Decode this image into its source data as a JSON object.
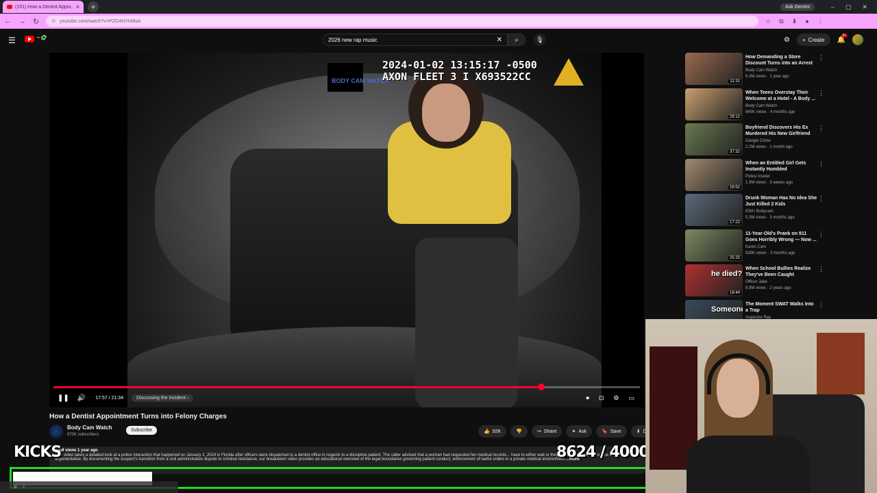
{
  "browser": {
    "tab_title": "(151) How a Dentist Appoi...",
    "url": "youtube.com/watch?v=PZG4NYHi8sA",
    "ask_gemini": "Ask Gemini"
  },
  "masthead": {
    "search_query": "2026 new rap music",
    "create_label": "Create",
    "notif_count": "9+"
  },
  "player": {
    "cam_timestamp": "2024-01-02 13:15:17 -0500",
    "cam_device": "AXON FLEET 3 I X693522CC",
    "watermark": "BODY CAM WATCH",
    "current_time": "17:57",
    "duration": "21:34",
    "time_display": "17:57 / 21:34",
    "chapter": "Discussing the Incident",
    "progress": 0.832
  },
  "video": {
    "title": "How a Dentist Appointment Turns into Felony Charges",
    "channel": "Body Cam Watch",
    "subscribers": "970K subscribers",
    "subscribe_label": "Subscribe",
    "likes": "92K",
    "share_label": "Share",
    "ask_label": "Ask",
    "save_label": "Save",
    "download_label": "Dow",
    "views_date": "2.8M views  1 year ago",
    "description": "This video takes a detailed look at a police interaction that happened on January 2, 2024 in Florida after officers were dispatched to a dentist office in regards to a disruptive patient. The caller advised that a woman had requested her medical records... have to either wait or they could be mailed to her, she became argumentative. By documenting the suspect's transition from a civil administrative dispute to criminal resistance, our breakdown video provides an educational overview of the legal boundaries governing patient conduct, enforcement of lawful orders in a private medical environment",
    "more_label": "...more"
  },
  "overlay": {
    "kicks_label": "KICKS",
    "goal_current": 8624,
    "goal_target": 40000,
    "goal_text": "8624 / 40000",
    "goal_color": "#22dd22"
  },
  "recommendations": [
    {
      "title": "How Demanding a Store Discount Turns into an Arrest",
      "channel": "Body Cam Watch",
      "meta": "6.3M views · 1 year ago",
      "duration": "11:31",
      "color": "#9a6a50"
    },
    {
      "title": "When Teens Overstay Their Welcome at a Hotel - A Body ...",
      "channel": "Body Cam Watch",
      "meta": "845K views · 4 months ago",
      "duration": "29:12",
      "color": "#c8a070"
    },
    {
      "title": "Boyfriend Discovers His Ex Murdered His New Girlfriend",
      "channel": "Dangle Crime",
      "meta": "2.2M views · 1 month ago",
      "duration": "37:32",
      "color": "#6a7a50"
    },
    {
      "title": "When an Entitled Girl Gets Instantly Humbled",
      "channel": "Police Insider",
      "meta": "1.9M views · 3 weeks ago",
      "duration": "16:52",
      "color": "#a08a70"
    },
    {
      "title": "Drunk Woman Has No Idea She Just Killed 2 Kids",
      "channel": "EWU Bodycam",
      "meta": "5.3M views · 3 months ago",
      "duration": "17:22",
      "color": "#5a6a7a"
    },
    {
      "title": "11-Year-Old's Prank on 911 Goes Horribly Wrong — Now ...",
      "channel": "Karen Cam",
      "meta": "928K views · 3 months ago",
      "duration": "25:25",
      "color": "#7a8a60"
    },
    {
      "title": "When School Bullies Realize They've Been Caught",
      "channel": "Officer Jake",
      "meta": "8.9M views · 2 years ago",
      "duration": "18:44",
      "color": "#b03030",
      "thumb_text": "he died?"
    },
    {
      "title": "The Moment SWAT Walks Into a Trap",
      "channel": "Inspector Ray",
      "meta": "",
      "duration": "",
      "color": "#3a4a5a",
      "thumb_text": "Someone's"
    }
  ],
  "colors": {
    "accent": "#ff0033",
    "browser_theme": "#f6a4ff",
    "bg": "#0f0f0f"
  }
}
